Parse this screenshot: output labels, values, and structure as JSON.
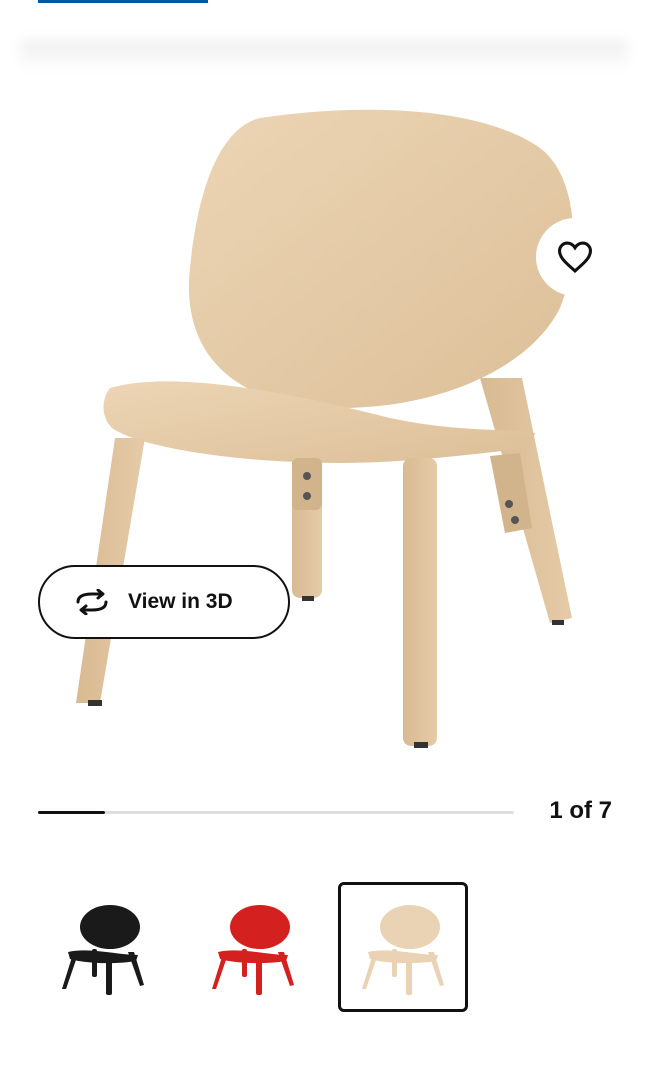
{
  "header": {
    "accent_color": "#0058a3"
  },
  "gallery": {
    "image_alt": "Wooden lounge chair, white stained oak veneer",
    "favourite_icon": "heart-outline-icon",
    "view_3d": {
      "label": "View in 3D",
      "icon": "rotate-3d-icon"
    },
    "pagination": {
      "current": 1,
      "total": 7,
      "text": "1 of 7",
      "progress_fraction": 0.14
    },
    "thumbnails": [
      {
        "variant": "black",
        "color": "#1a1a1a",
        "selected": false
      },
      {
        "variant": "red",
        "color": "#d4201f",
        "selected": false
      },
      {
        "variant": "white stained oak",
        "color": "#e9d3b4",
        "selected": true
      }
    ]
  }
}
